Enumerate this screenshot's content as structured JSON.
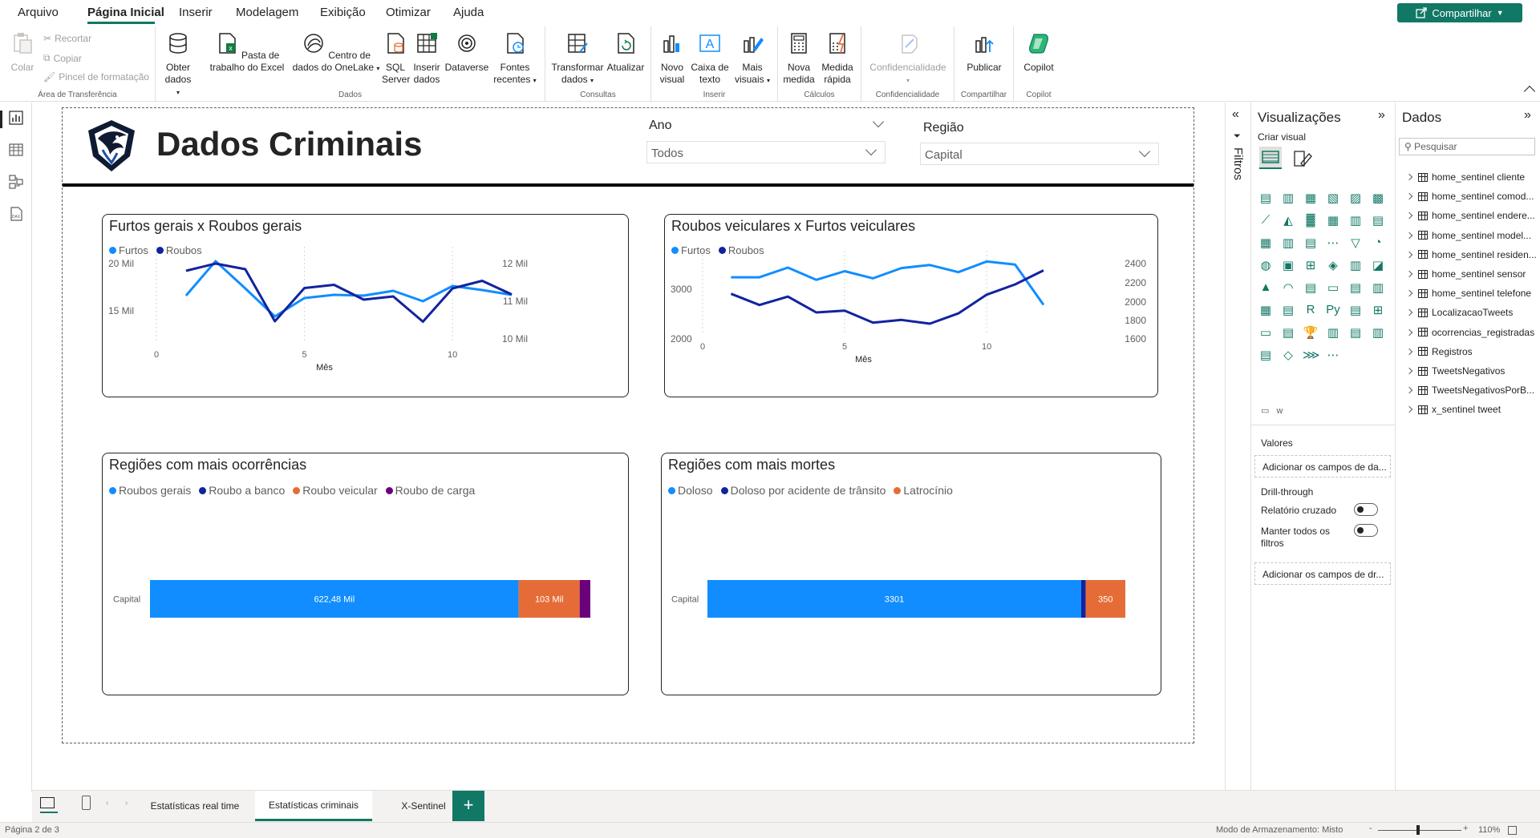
{
  "menu": {
    "items": [
      "Arquivo",
      "Página Inicial",
      "Inserir",
      "Modelagem",
      "Exibição",
      "Otimizar",
      "Ajuda"
    ],
    "share_label": "Compartilhar"
  },
  "ribbon": {
    "clipboard": {
      "paste": "Colar",
      "cut": "Recortar",
      "copy": "Copiar",
      "format_painter": "Pincel de formatação",
      "group": "Área de Transferência"
    },
    "data": {
      "get_data": "Obter dados",
      "excel": "Pasta de trabalho do Excel",
      "onelake": "Centro de dados do OneLake",
      "sql": "SQL Server",
      "enter_data": "Inserir dados",
      "dataverse": "Dataverse",
      "recent": "Fontes recentes",
      "group": "Dados"
    },
    "queries": {
      "transform": "Transformar dados",
      "refresh": "Atualizar",
      "group": "Consultas"
    },
    "insert": {
      "new_visual": "Novo visual",
      "text_box": "Caixa de texto",
      "more_visuals": "Mais visuais",
      "group": "Inserir"
    },
    "calc": {
      "new_measure": "Nova medida",
      "quick_measure": "Medida rápida",
      "group": "Cálculos"
    },
    "sensitivity": {
      "label": "Confidencialidade",
      "group": "Confidencialidade"
    },
    "share": {
      "publish": "Publicar",
      "group": "Compartilhar"
    },
    "copilot": {
      "label": "Copilot",
      "group": "Copilot"
    }
  },
  "report": {
    "title": "Dados Criminais",
    "slicer_year": {
      "label": "Ano",
      "value": "Todos"
    },
    "slicer_region": {
      "label": "Região",
      "value": "Capital"
    }
  },
  "colors": {
    "light_blue": "#118DFF",
    "dark_blue": "#12239E",
    "orange": "#E66C37",
    "purple": "#6B007B",
    "accent": "#117865"
  },
  "chart_data": [
    {
      "type": "line",
      "title": "Furtos gerais x Roubos gerais",
      "xlabel": "Mês",
      "x_ticks": [
        "0",
        "5",
        "10"
      ],
      "xlim": [
        0,
        12
      ],
      "y_ticks_left": [
        "20 Mil",
        "15 Mil"
      ],
      "y_ticks_right": [
        "12 Mil",
        "11 Mil",
        "10 Mil"
      ],
      "series": [
        {
          "name": "Furtos",
          "axis": "left",
          "color": "#118DFF",
          "x": [
            1,
            2,
            3,
            4,
            5,
            6,
            7,
            8,
            9,
            10,
            11,
            12
          ],
          "values": [
            15900,
            20200,
            16800,
            13300,
            15600,
            16000,
            15900,
            16500,
            15200,
            17100,
            16600,
            16000
          ]
        },
        {
          "name": "Roubos",
          "axis": "right",
          "color": "#12239E",
          "x": [
            1,
            2,
            3,
            4,
            5,
            6,
            7,
            8,
            9,
            10,
            11,
            12
          ],
          "values": [
            11600,
            11780,
            11640,
            10340,
            11170,
            11250,
            10880,
            10960,
            10330,
            11160,
            11350,
            11010
          ]
        }
      ],
      "ylim_left": [
        10000,
        22000
      ],
      "ylim_right": [
        9800,
        12200
      ]
    },
    {
      "type": "line",
      "title": "Roubos veiculares x Furtos veiculares",
      "xlabel": "Mês",
      "x_ticks": [
        "0",
        "5",
        "10"
      ],
      "xlim": [
        0,
        12
      ],
      "y_ticks_left": [
        "3000",
        "2000"
      ],
      "y_ticks_right": [
        "2400",
        "2200",
        "2000",
        "1800",
        "1600"
      ],
      "series": [
        {
          "name": "Furtos",
          "axis": "left",
          "color": "#118DFF",
          "x": [
            1,
            2,
            3,
            4,
            5,
            6,
            7,
            8,
            9,
            10,
            11,
            12
          ],
          "values": [
            2980,
            2980,
            3170,
            2930,
            3100,
            2960,
            3160,
            3220,
            3080,
            3290,
            3230,
            2440
          ]
        },
        {
          "name": "Roubos",
          "axis": "right",
          "color": "#12239E",
          "x": [
            1,
            2,
            3,
            4,
            5,
            6,
            7,
            8,
            9,
            10,
            11,
            12
          ],
          "values": [
            1990,
            1870,
            1960,
            1790,
            1810,
            1680,
            1710,
            1670,
            1780,
            1980,
            2090,
            2240
          ]
        }
      ],
      "ylim_left": [
        1850,
        3500
      ],
      "ylim_right": [
        1550,
        2450
      ]
    },
    {
      "type": "bar",
      "stacked": true,
      "orientation": "horizontal",
      "title": "Regiões com mais ocorrências",
      "categories": [
        "Capital"
      ],
      "series": [
        {
          "name": "Roubos gerais",
          "color": "#118DFF",
          "values": [
            622480
          ],
          "label": "622,48 Mil"
        },
        {
          "name": "Roubo a banco",
          "color": "#12239E",
          "values": [
            0
          ],
          "label": ""
        },
        {
          "name": "Roubo veicular",
          "color": "#E66C37",
          "values": [
            103000
          ],
          "label": "103 Mil"
        },
        {
          "name": "Roubo de carga",
          "color": "#6B007B",
          "values": [
            18000
          ],
          "label": ""
        }
      ]
    },
    {
      "type": "bar",
      "stacked": true,
      "orientation": "horizontal",
      "title": "Regiões com mais mortes",
      "categories": [
        "Capital"
      ],
      "series": [
        {
          "name": "Doloso",
          "color": "#118DFF",
          "values": [
            3301
          ],
          "label": "3301"
        },
        {
          "name": "Doloso por acidente de trânsito",
          "color": "#12239E",
          "values": [
            40
          ],
          "label": ""
        },
        {
          "name": "Latrocínio",
          "color": "#E66C37",
          "values": [
            350
          ],
          "label": "350"
        }
      ]
    }
  ],
  "filters_label": "Filtros",
  "viz_pane": {
    "title": "Visualizações",
    "create_visual": "Criar visual",
    "values_label": "Valores",
    "values_placeholder": "Adicionar os campos de da...",
    "drill_label": "Drill-through",
    "cross_report": "Relatório cruzado",
    "keep_filters": "Manter todos os filtros",
    "drill_placeholder": "Adicionar os campos de dr..."
  },
  "data_pane": {
    "title": "Dados",
    "search_placeholder": "Pesquisar",
    "tables": [
      "home_sentinel cliente",
      "home_sentinel comod...",
      "home_sentinel endere...",
      "home_sentinel model...",
      "home_sentinel residen...",
      "home_sentinel sensor",
      "home_sentinel telefone",
      "LocalizacaoTweets",
      "ocorrencias_registradas",
      "Registros",
      "TweetsNegativos",
      "TweetsNegativosPorB...",
      "x_sentinel tweet"
    ]
  },
  "tabs": [
    "Estatísticas real time",
    "Estatísticas criminais",
    "X-Sentinel"
  ],
  "status": {
    "page": "Página 2 de 3",
    "storage": "Modo de Armazenamento: Misto",
    "zoom": "110%"
  }
}
